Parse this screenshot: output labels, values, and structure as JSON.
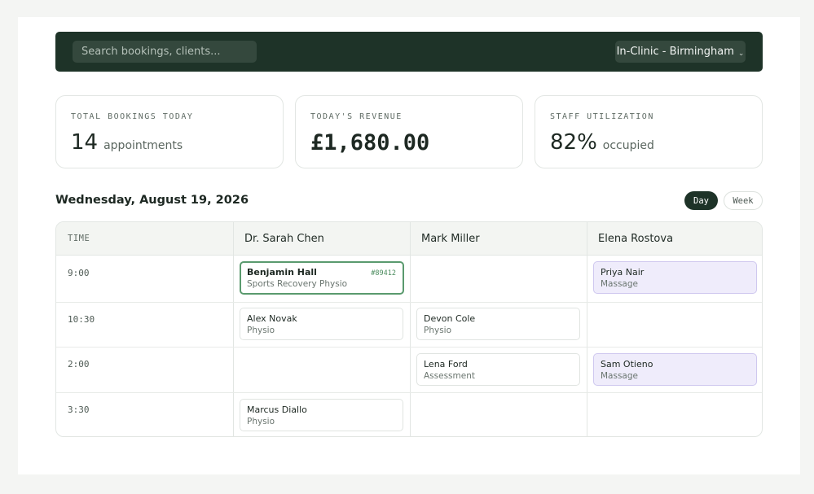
{
  "header": {
    "search_placeholder": "Search bookings, clients...",
    "location_label": "In-Clinic - Birmingham",
    "location_chevron": "⌄"
  },
  "stats": [
    {
      "label": "TOTAL BOOKINGS TODAY",
      "value": "14",
      "unit": "appointments"
    },
    {
      "label": "TODAY'S REVENUE",
      "value": "£1,680.00",
      "unit": ""
    },
    {
      "label": "STAFF UTILIZATION",
      "value": "82%",
      "unit": "occupied"
    }
  ],
  "schedule": {
    "date": "Wednesday, August 19, 2026",
    "view_toggle": {
      "day": "Day",
      "week": "Week",
      "active": "Day"
    },
    "columns": {
      "time": "TIME",
      "staff": [
        "Dr. Sarah Chen",
        "Mark Miller",
        "Elena Rostova"
      ]
    },
    "times": [
      "9:00",
      "10:30",
      "2:00",
      "3:30"
    ],
    "appointments": {
      "benjamin": {
        "name": "Benjamin Hall",
        "service": "Sports Recovery Physio",
        "ref": "#89412"
      },
      "priya": {
        "name": "Priya Nair",
        "service": "Massage"
      },
      "alex": {
        "name": "Alex Novak",
        "service": "Physio"
      },
      "devon": {
        "name": "Devon Cole",
        "service": "Physio"
      },
      "lena": {
        "name": "Lena Ford",
        "service": "Assessment"
      },
      "sam": {
        "name": "Sam Otieno",
        "service": "Massage"
      },
      "marcus": {
        "name": "Marcus Diallo",
        "service": "Physio"
      }
    }
  },
  "colors": {
    "brand_dark": "#1e3328",
    "highlight_border": "#5a9a6e",
    "massage_bg": "#efecfb"
  }
}
